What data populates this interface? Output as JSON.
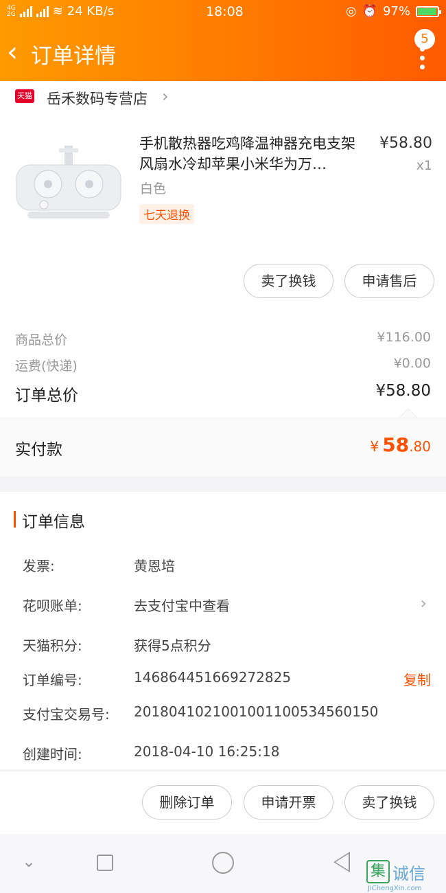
{
  "status_bar": {
    "network": "4G",
    "network2": "2G",
    "speed": "24 KB/s",
    "time": "18:08",
    "battery": "97%",
    "battery_level": 0.97
  },
  "nav": {
    "title": "订单详情",
    "badge": "5"
  },
  "store": {
    "logo": "天猫",
    "name": "岳禾数码专营店"
  },
  "product": {
    "title": "手机散热器吃鸡降温神器充电支架风扇水冷却苹果小米华为万…",
    "price": "¥58.80",
    "qty": "x1",
    "spec": "白色",
    "tag": "七天退换",
    "btn_sell": "卖了换钱",
    "btn_after": "申请售后"
  },
  "summary": {
    "goods_label": "商品总价",
    "goods_value": "¥116.00",
    "ship_label": "运费(快递)",
    "ship_value": "¥0.00",
    "total_label": "订单总价",
    "total_value": "¥58.80"
  },
  "paid": {
    "label": "实付款",
    "symbol": "¥",
    "int": "58",
    "dec": ".80"
  },
  "info": {
    "title": "订单信息",
    "rows": [
      {
        "label": "发票:",
        "value": "黄恩培"
      },
      {
        "label": "花呗账单:",
        "value": "去支付宝中查看"
      },
      {
        "label": "天猫积分:",
        "value": "获得5点积分"
      },
      {
        "label": "订单编号:",
        "value": "146864451669272825",
        "action": "复制"
      },
      {
        "label": "支付宝交易号:",
        "value": "2018041021001001100534560150"
      },
      {
        "label": "创建时间:",
        "value": "2018-04-10 16:25:18"
      }
    ]
  },
  "actions": {
    "delete": "删除订单",
    "invoice": "申请开票",
    "sell": "卖了换钱"
  },
  "watermark": {
    "logo": "集",
    "text": "诚信",
    "url": "JiChengXin.com"
  },
  "colors": {
    "accent": "#ff5000",
    "header_start": "#ff9a00",
    "header_end": "#ff5a00"
  }
}
